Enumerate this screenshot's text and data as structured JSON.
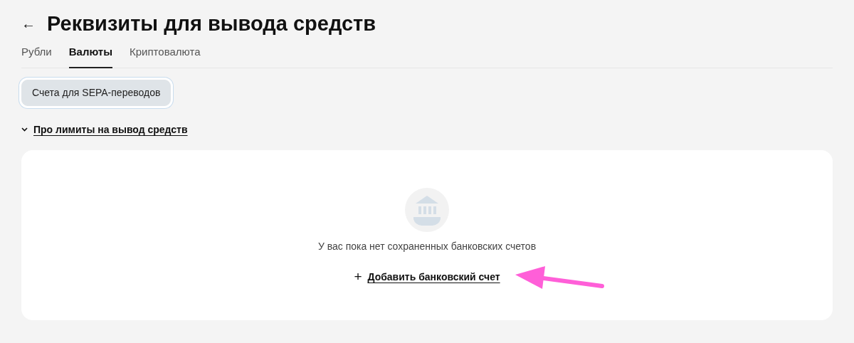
{
  "header": {
    "back": "←",
    "title": "Реквизиты для вывода средств"
  },
  "tabs": [
    {
      "label": "Рубли",
      "selected": false
    },
    {
      "label": "Валюты",
      "selected": true
    },
    {
      "label": "Криптовалюта",
      "selected": false
    }
  ],
  "chips": [
    {
      "label": "Счета для SEPA-переводов",
      "selected": true
    }
  ],
  "limits_link": {
    "label": "Про лимиты на вывод средств",
    "expanded": false
  },
  "empty_state": {
    "message": "У вас пока нет сохраненных банковских счетов",
    "add_icon": "+",
    "add_link": "Добавить банковский счет"
  }
}
